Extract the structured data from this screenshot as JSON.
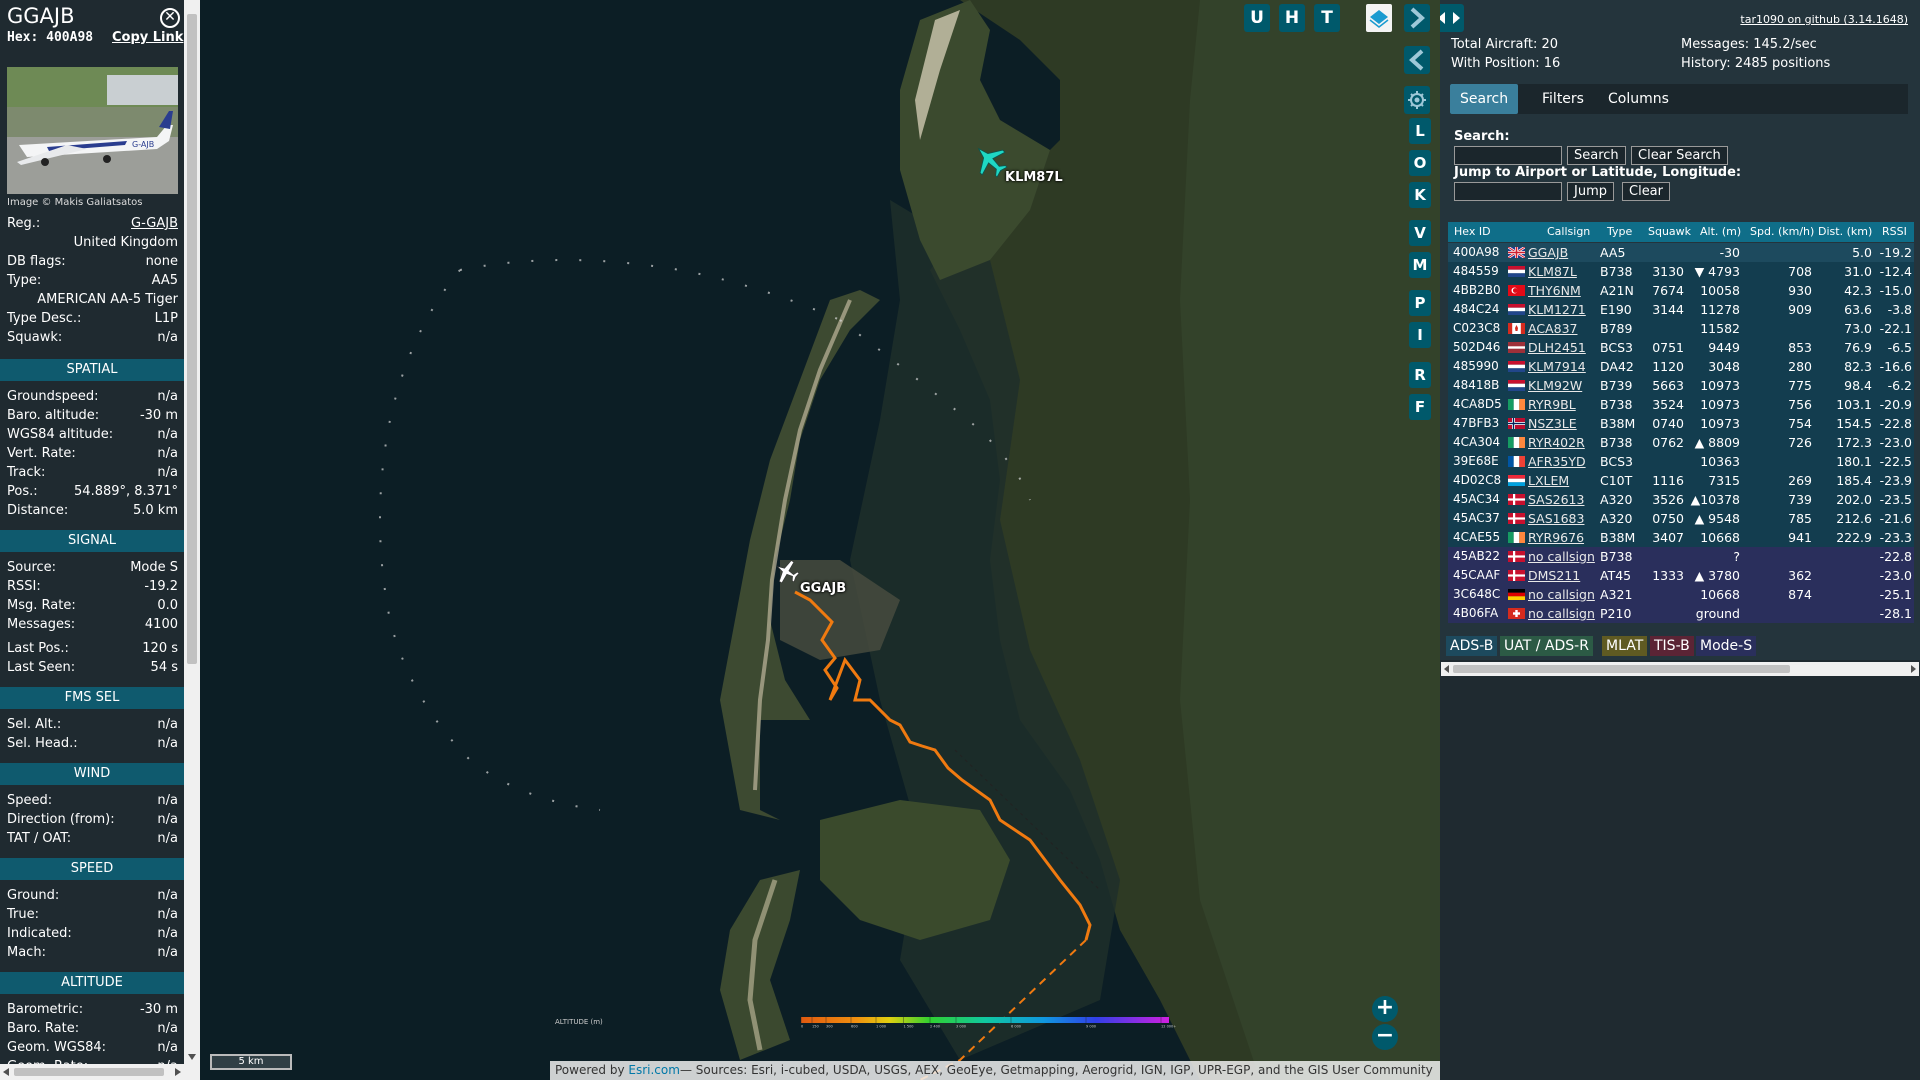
{
  "info": {
    "callsign": "GGAJB",
    "hex_label": "Hex:",
    "hex": "400A98",
    "copy_link": "Copy Link",
    "image_credit": "Image © Makis Galiatsatos",
    "rows_top": [
      {
        "k": "Reg.:",
        "v": "G-GAJB",
        "link": true
      },
      {
        "k": "",
        "v": "United Kingdom"
      },
      {
        "k": "DB flags:",
        "v": "none"
      },
      {
        "k": "Type:",
        "v": "AA5"
      },
      {
        "k": "",
        "v": "AMERICAN AA-5 Tiger"
      },
      {
        "k": "Type Desc.:",
        "v": "L1P"
      },
      {
        "k": "Squawk:",
        "v": "n/a"
      }
    ],
    "sections": [
      {
        "title": "SPATIAL",
        "rows": [
          {
            "k": "Groundspeed:",
            "v": "n/a"
          },
          {
            "k": "Baro. altitude:",
            "v": "-30 m"
          },
          {
            "k": "WGS84 altitude:",
            "v": "n/a"
          },
          {
            "k": "Vert. Rate:",
            "v": "n/a"
          },
          {
            "k": "Track:",
            "v": "n/a"
          },
          {
            "k": "Pos.:",
            "v": "54.889°, 8.371°"
          },
          {
            "k": "Distance:",
            "v": "5.0 km"
          }
        ]
      },
      {
        "title": "SIGNAL",
        "rows": [
          {
            "k": "Source:",
            "v": "Mode S"
          },
          {
            "k": "RSSI:",
            "v": "-19.2"
          },
          {
            "k": "Msg. Rate:",
            "v": "0.0"
          },
          {
            "k": "Messages:",
            "v": "4100"
          },
          {
            "k": "Last Pos.:",
            "v": "120 s"
          },
          {
            "k": "Last Seen:",
            "v": "54 s"
          }
        ]
      },
      {
        "title": "FMS SEL",
        "rows": [
          {
            "k": "Sel. Alt.:",
            "v": "n/a"
          },
          {
            "k": "Sel. Head.:",
            "v": "n/a"
          }
        ]
      },
      {
        "title": "WIND",
        "rows": [
          {
            "k": "Speed:",
            "v": "n/a"
          },
          {
            "k": "Direction (from):",
            "v": "n/a"
          },
          {
            "k": "TAT / OAT:",
            "v": "n/a"
          }
        ]
      },
      {
        "title": "SPEED",
        "rows": [
          {
            "k": "Ground:",
            "v": "n/a"
          },
          {
            "k": "True:",
            "v": "n/a"
          },
          {
            "k": "Indicated:",
            "v": "n/a"
          },
          {
            "k": "Mach:",
            "v": "n/a"
          }
        ]
      },
      {
        "title": "ALTITUDE",
        "rows": [
          {
            "k": "Barometric:",
            "v": "-30 m"
          },
          {
            "k": "Baro. Rate:",
            "v": "n/a"
          },
          {
            "k": "Geom. WGS84:",
            "v": "n/a"
          },
          {
            "k": "Geom. Rate:",
            "v": "n/a"
          }
        ]
      }
    ]
  },
  "map": {
    "buttons": [
      "U",
      "H",
      "T"
    ],
    "side_buttons": [
      "L",
      "O",
      "K",
      "V",
      "M",
      "P",
      "I",
      "R",
      "F"
    ],
    "zoom_in": "+",
    "zoom_out": "−",
    "scale_label": "5 km",
    "legend_label": "ALTITUDE (m)",
    "legend_ticks": [
      "0",
      "150",
      "300",
      "600",
      "1 000",
      "1 500",
      "2 400",
      "3 000",
      "6 000",
      "9 000",
      "12 000+"
    ],
    "attribution_prefix": "Powered by",
    "attribution_link": "Esri.com",
    "attribution_rest": "— Sources: Esri, i-cubed, USDA, USGS, AEX, GeoEye, Getmapping, Aerogrid, IGN, IGP, UPR-EGP, and the GIS User Community",
    "aircraft_labels": {
      "klm": "KLM87L",
      "ggajb": "GGAJB"
    },
    "colors": {
      "water": "#0c1e25",
      "land": "#2e3a24",
      "track": "#f07a10",
      "selected_plane": "#ffffff",
      "other_plane": "#1fd8c4",
      "accent": "#00596b"
    }
  },
  "sidebar": {
    "github_link": "tar1090 on github (3.14.1648)",
    "total_aircraft": "Total Aircraft: 20",
    "with_position": "With Position: 16",
    "messages": "Messages: 145.2/sec",
    "history": "History: 2485 positions",
    "tabs": [
      "Search",
      "Filters",
      "Columns"
    ],
    "search_label": "Search:",
    "search_button": "Search",
    "clear_search_button": "Clear Search",
    "jump_label": "Jump to Airport or Latitude, Longitude:",
    "jump_button": "Jump",
    "clear_button": "Clear",
    "columns": [
      "Hex ID",
      "Callsign",
      "Type",
      "Squawk",
      "Alt. (m)",
      "Spd. (km/h)",
      "Dist. (km)",
      "RSSI"
    ],
    "rows": [
      {
        "hex": "400A98",
        "flag": "gb",
        "callsign": "GGAJB",
        "type": "AA5",
        "squawk": "",
        "alt": "-30",
        "spd": "",
        "dist": "5.0",
        "rssi": "-19.2"
      },
      {
        "hex": "484559",
        "flag": "nl",
        "callsign": "KLM87L",
        "type": "B738",
        "squawk": "3130",
        "alt": "▼ 4793",
        "spd": "708",
        "dist": "31.0",
        "rssi": "-12.4"
      },
      {
        "hex": "4BB2B0",
        "flag": "tr",
        "callsign": "THY6NM",
        "type": "A21N",
        "squawk": "7674",
        "alt": "10058",
        "spd": "930",
        "dist": "42.3",
        "rssi": "-15.0"
      },
      {
        "hex": "484C24",
        "flag": "nl",
        "callsign": "KLM1271",
        "type": "E190",
        "squawk": "3144",
        "alt": "11278",
        "spd": "909",
        "dist": "63.6",
        "rssi": "-3.8"
      },
      {
        "hex": "C023C8",
        "flag": "ca",
        "callsign": "ACA837",
        "type": "B789",
        "squawk": "",
        "alt": "11582",
        "spd": "",
        "dist": "73.0",
        "rssi": "-22.1"
      },
      {
        "hex": "502D46",
        "flag": "lv",
        "callsign": "DLH2451",
        "type": "BCS3",
        "squawk": "0751",
        "alt": "9449",
        "spd": "853",
        "dist": "76.9",
        "rssi": "-6.5"
      },
      {
        "hex": "485990",
        "flag": "nl",
        "callsign": "KLM7914",
        "type": "DA42",
        "squawk": "1120",
        "alt": "3048",
        "spd": "280",
        "dist": "82.3",
        "rssi": "-16.6"
      },
      {
        "hex": "48418B",
        "flag": "nl",
        "callsign": "KLM92W",
        "type": "B739",
        "squawk": "5663",
        "alt": "10973",
        "spd": "775",
        "dist": "98.4",
        "rssi": "-6.2"
      },
      {
        "hex": "4CA8D5",
        "flag": "ie",
        "callsign": "RYR9BL",
        "type": "B738",
        "squawk": "3524",
        "alt": "10973",
        "spd": "756",
        "dist": "103.1",
        "rssi": "-20.9"
      },
      {
        "hex": "47BFB3",
        "flag": "no",
        "callsign": "NSZ3LE",
        "type": "B38M",
        "squawk": "0740",
        "alt": "10973",
        "spd": "754",
        "dist": "154.5",
        "rssi": "-22.8"
      },
      {
        "hex": "4CA304",
        "flag": "ie",
        "callsign": "RYR402R",
        "type": "B738",
        "squawk": "0762",
        "alt": "▲ 8809",
        "spd": "726",
        "dist": "172.3",
        "rssi": "-23.0"
      },
      {
        "hex": "39E68E",
        "flag": "fr",
        "callsign": "AFR35YD",
        "type": "BCS3",
        "squawk": "",
        "alt": "10363",
        "spd": "",
        "dist": "180.1",
        "rssi": "-22.5"
      },
      {
        "hex": "4D02C8",
        "flag": "lu",
        "callsign": "LXLEM",
        "type": "C10T",
        "squawk": "1116",
        "alt": "7315",
        "spd": "269",
        "dist": "185.4",
        "rssi": "-23.9"
      },
      {
        "hex": "45AC34",
        "flag": "dk",
        "callsign": "SAS2613",
        "type": "A320",
        "squawk": "3526",
        "alt": "▲10378",
        "spd": "739",
        "dist": "202.0",
        "rssi": "-23.5"
      },
      {
        "hex": "45AC37",
        "flag": "dk",
        "callsign": "SAS1683",
        "type": "A320",
        "squawk": "0750",
        "alt": "▲ 9548",
        "spd": "785",
        "dist": "212.6",
        "rssi": "-21.6"
      },
      {
        "hex": "4CAE55",
        "flag": "ie",
        "callsign": "RYR9676",
        "type": "B38M",
        "squawk": "3407",
        "alt": "10668",
        "spd": "941",
        "dist": "222.9",
        "rssi": "-23.3"
      },
      {
        "hex": "45AB22",
        "flag": "dk",
        "callsign": "no callsign",
        "type": "B738",
        "squawk": "",
        "alt": "?",
        "spd": "",
        "dist": "",
        "rssi": "-22.8"
      },
      {
        "hex": "45CAAF",
        "flag": "dk",
        "callsign": "DMS211",
        "type": "AT45",
        "squawk": "1333",
        "alt": "▲ 3780",
        "spd": "362",
        "dist": "",
        "rssi": "-23.0"
      },
      {
        "hex": "3C648C",
        "flag": "de",
        "callsign": "no callsign",
        "type": "A321",
        "squawk": "",
        "alt": "10668",
        "spd": "874",
        "dist": "",
        "rssi": "-25.1"
      },
      {
        "hex": "4B06FA",
        "flag": "ch",
        "callsign": "no callsign",
        "type": "P210",
        "squawk": "",
        "alt": "ground",
        "spd": "",
        "dist": "",
        "rssi": "-28.1"
      }
    ],
    "source_legend": [
      {
        "label": "ADS-B",
        "color": "#1d4a5e"
      },
      {
        "label": "UAT / ADS-R",
        "color": "#2c5a45"
      },
      {
        "label": "MLAT",
        "color": "#5f5a22"
      },
      {
        "label": "TIS-B",
        "color": "#5b2435"
      },
      {
        "label": "Mode-S",
        "color": "#2a2f5c"
      }
    ]
  }
}
